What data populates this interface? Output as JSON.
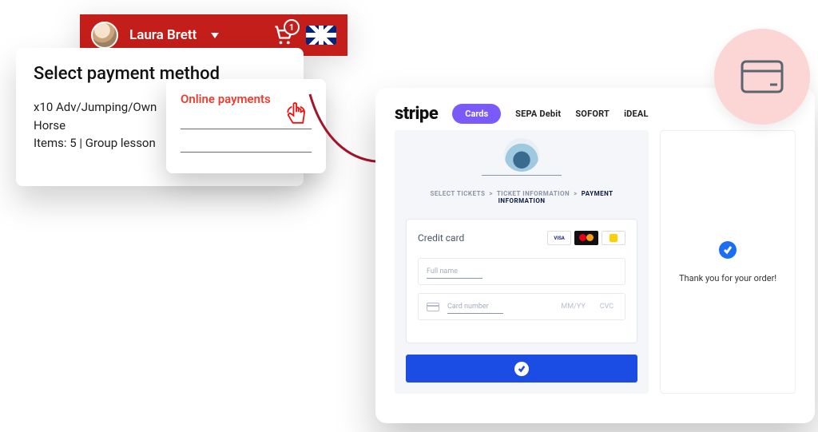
{
  "header": {
    "user_name": "Laura Brett",
    "cart_count": "1"
  },
  "panel": {
    "title": "Select payment method",
    "line1": "x10 Adv/Jumping/Own",
    "line2": "Horse",
    "line3": "Items: 5 | Group lesson"
  },
  "tooltip": {
    "title": "Online payments"
  },
  "stripe": {
    "logo": "stripe",
    "tabs": {
      "cards": "Cards",
      "sepa": "SEPA Debit",
      "sofort": "SOFORT",
      "ideal": "iDEAL"
    },
    "crumbs": {
      "a": "SELECT TICKETS",
      "b": "TICKET INFORMATION",
      "c": "PAYMENT INFORMATION",
      "sep": ">"
    },
    "cc_label": "Credit card",
    "brands": {
      "visa": "VISA",
      "bancontact": "Bancontact"
    },
    "fields": {
      "full_name": "Full name",
      "card_number": "Card number",
      "mmyy": "MM/YY",
      "cvc": "CVC"
    },
    "thankyou": "Thank you for your order!"
  }
}
